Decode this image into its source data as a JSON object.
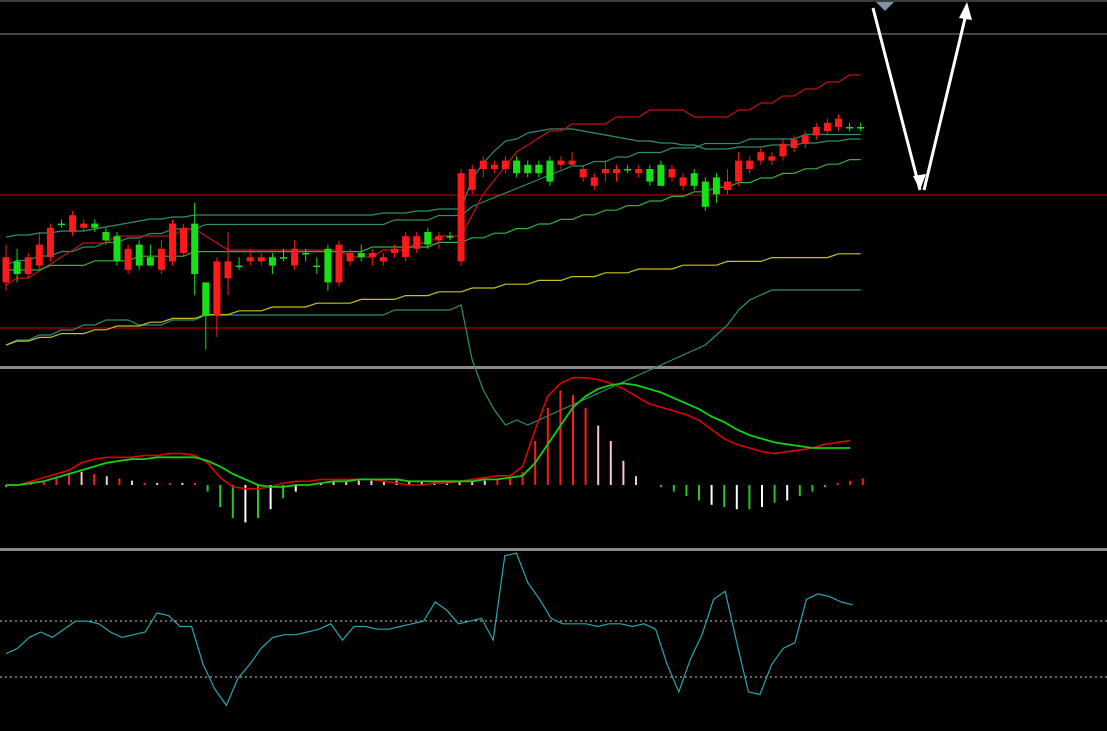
{
  "chart_data": [
    {
      "type": "candlestick",
      "panel": "price",
      "y_scale": "inverted_visual",
      "ylim": [
        0,
        100
      ],
      "colors": {
        "up": "#ff1a1a",
        "down": "#18e018",
        "boll": "#2c8f72",
        "ma_fast": "#c81010",
        "ma_mid": "#35b23a",
        "ma_slow": "#c8c020"
      },
      "ohlc": [
        [
          32,
          26,
          34,
          23
        ],
        [
          27,
          30,
          32,
          24
        ],
        [
          30,
          26,
          31,
          25
        ],
        [
          28,
          23,
          29,
          20
        ],
        [
          26,
          19,
          27,
          18
        ],
        [
          18,
          18,
          19,
          17
        ],
        [
          20,
          16,
          21,
          15
        ],
        [
          19,
          18,
          20,
          17
        ],
        [
          18,
          19,
          20,
          17
        ],
        [
          20,
          22,
          23,
          19
        ],
        [
          21,
          27,
          28,
          20
        ],
        [
          29,
          24,
          30,
          23
        ],
        [
          23,
          28,
          29,
          22
        ],
        [
          26,
          28,
          28,
          23
        ],
        [
          29,
          24,
          30,
          22
        ],
        [
          27,
          18,
          28,
          17
        ],
        [
          25,
          19,
          26,
          18
        ],
        [
          18,
          30,
          35,
          13
        ],
        [
          32,
          40,
          48,
          38
        ],
        [
          40,
          27,
          45,
          26
        ],
        [
          31,
          27,
          35,
          20
        ],
        [
          28,
          28,
          29,
          26
        ],
        [
          27,
          26,
          28,
          24
        ],
        [
          27,
          26,
          28,
          25
        ],
        [
          26,
          28,
          30,
          25
        ],
        [
          26,
          26,
          27,
          24
        ],
        [
          28,
          24,
          29,
          22
        ],
        [
          25,
          25,
          27,
          24
        ],
        [
          28,
          28,
          30,
          26
        ],
        [
          24,
          32,
          34,
          23
        ],
        [
          32,
          23,
          33,
          22
        ],
        [
          27,
          25,
          28,
          24
        ],
        [
          25,
          26,
          27,
          23
        ],
        [
          26,
          25,
          28,
          24
        ],
        [
          27,
          26,
          28,
          25
        ],
        [
          25,
          24,
          26,
          23
        ],
        [
          26,
          21,
          27,
          20
        ],
        [
          24,
          21,
          25,
          20
        ],
        [
          20,
          23,
          24,
          19
        ],
        [
          22,
          21,
          24,
          20
        ],
        [
          21,
          21,
          22,
          20
        ],
        [
          27,
          6,
          28,
          5
        ],
        [
          10,
          5,
          11,
          4
        ],
        [
          5,
          3,
          7,
          2
        ],
        [
          5,
          4,
          6,
          3
        ],
        [
          5,
          3,
          6,
          2
        ],
        [
          3,
          6,
          7,
          2
        ],
        [
          4,
          6,
          7,
          3
        ],
        [
          4,
          6,
          7,
          3
        ],
        [
          3,
          8,
          9,
          2
        ],
        [
          4,
          3,
          5,
          2
        ],
        [
          4,
          3,
          4,
          1
        ],
        [
          7,
          5,
          8,
          4
        ],
        [
          9,
          7,
          10,
          6
        ],
        [
          6,
          5,
          8,
          3
        ],
        [
          6,
          5,
          8,
          4
        ],
        [
          5,
          5,
          6,
          4
        ],
        [
          6,
          5,
          7,
          4
        ],
        [
          5,
          8,
          9,
          4
        ],
        [
          4,
          9,
          9,
          3
        ],
        [
          7,
          5,
          8,
          4
        ],
        [
          9,
          7,
          10,
          6
        ],
        [
          6,
          9,
          10,
          5
        ],
        [
          8,
          14,
          15,
          7
        ],
        [
          7,
          11,
          13,
          6
        ],
        [
          10,
          8,
          11,
          5
        ],
        [
          8,
          3,
          9,
          1
        ],
        [
          5,
          3,
          6,
          2
        ],
        [
          3,
          1,
          4,
          0
        ],
        [
          3,
          2,
          4,
          1
        ],
        [
          2,
          -1,
          3,
          -2
        ],
        [
          0,
          -2,
          1,
          -3
        ],
        [
          -1,
          -3,
          0,
          -4
        ],
        [
          -3,
          -5,
          -2,
          -6
        ],
        [
          -4,
          -6,
          -3,
          -7
        ],
        [
          -5,
          -7,
          -4,
          -8
        ],
        [
          -5,
          -5,
          -4,
          -6
        ],
        [
          -5,
          -5,
          -4,
          -6
        ]
      ],
      "series": [
        {
          "key": "boll_upper",
          "values": [
            49,
            48,
            48,
            47,
            47,
            46,
            46,
            46,
            45,
            44,
            43,
            42,
            41,
            40,
            40,
            39,
            39,
            38,
            38,
            38,
            38,
            38,
            38,
            38,
            38,
            38,
            38,
            38,
            38,
            38,
            38,
            38,
            38,
            38,
            37,
            37,
            37,
            36,
            36,
            35,
            35,
            35,
            20,
            12,
            6,
            1,
            0,
            -3,
            -4,
            -5,
            -5,
            -5,
            -4,
            -3,
            -2,
            -1,
            0,
            1,
            1,
            2,
            2,
            3,
            3,
            5,
            5,
            5,
            4,
            4,
            4,
            3,
            3,
            3,
            2,
            2,
            1,
            1,
            0,
            0
          ]
        },
        {
          "key": "boll_mid",
          "values": [
            35,
            34,
            34,
            33,
            33,
            32,
            32,
            31,
            31,
            30,
            30,
            29,
            29,
            28,
            28,
            27,
            27,
            27,
            26,
            26,
            26,
            26,
            26,
            26,
            26,
            26,
            26,
            26,
            26,
            26,
            26,
            26,
            26,
            26,
            26,
            25,
            25,
            25,
            25,
            24,
            24,
            24,
            22,
            21,
            20,
            19,
            18,
            17,
            16,
            15,
            14,
            13,
            13,
            12,
            12,
            11,
            11,
            10,
            10,
            10,
            9,
            9,
            9,
            8,
            8,
            8,
            8,
            7,
            7,
            7,
            7,
            7,
            6,
            6,
            6,
            6,
            6,
            6
          ]
        },
        {
          "key": "boll_lower",
          "values": [
            21,
            20,
            20,
            19,
            19,
            18,
            18,
            17,
            17,
            16,
            16,
            16,
            17,
            17,
            17,
            16,
            16,
            16,
            15,
            15,
            15,
            15,
            15,
            15,
            15,
            15,
            15,
            15,
            15,
            15,
            15,
            15,
            15,
            15,
            15,
            14,
            14,
            14,
            14,
            14,
            14,
            13,
            24,
            30,
            34,
            37,
            36,
            37,
            36,
            35,
            34,
            33,
            32,
            31,
            30,
            29,
            28,
            27,
            26,
            25,
            24,
            23,
            22,
            21,
            19,
            17,
            14,
            12,
            11,
            10,
            10,
            10,
            10,
            10,
            10,
            10,
            10,
            10
          ]
        },
        {
          "key": "ma_fast",
          "values": [
            30,
            29,
            29,
            28,
            27,
            26,
            25,
            24,
            24,
            24,
            23,
            23,
            23,
            23,
            23,
            23,
            22,
            22,
            23,
            24,
            25,
            25,
            25,
            25,
            25,
            25,
            25,
            25,
            25,
            25,
            25,
            26,
            26,
            26,
            25,
            25,
            25,
            24,
            24,
            23,
            23,
            23,
            20,
            17,
            15,
            13,
            11,
            10,
            9,
            8,
            8,
            7,
            7,
            7,
            7,
            6,
            6,
            6,
            5,
            5,
            5,
            5,
            6,
            6,
            6,
            6,
            5,
            5,
            4,
            4,
            3,
            3,
            2,
            2,
            1,
            1,
            0,
            0
          ]
        },
        {
          "key": "ma_mid",
          "values": [
            30,
            30,
            30,
            30,
            29,
            29,
            29,
            29,
            28,
            28,
            28,
            28,
            27,
            27,
            27,
            27,
            27,
            26,
            26,
            26,
            26,
            26,
            26,
            26,
            26,
            26,
            26,
            26,
            26,
            26,
            26,
            26,
            26,
            25,
            25,
            25,
            25,
            25,
            25,
            24,
            24,
            24,
            23,
            23,
            22,
            22,
            21,
            21,
            20,
            20,
            19,
            19,
            18,
            18,
            17,
            17,
            16,
            16,
            15,
            15,
            14,
            14,
            13,
            13,
            12,
            12,
            11,
            11,
            10,
            10,
            9,
            9,
            8,
            8,
            7,
            7,
            6,
            6
          ]
        },
        {
          "key": "ma_slow",
          "values": [
            45,
            44,
            44,
            43,
            43,
            42,
            42,
            42,
            41,
            41,
            40,
            40,
            40,
            39,
            39,
            38,
            38,
            38,
            37,
            37,
            37,
            36,
            36,
            36,
            35,
            35,
            35,
            35,
            34,
            34,
            34,
            34,
            33,
            33,
            33,
            33,
            32,
            32,
            32,
            31,
            31,
            31,
            30,
            30,
            30,
            29,
            29,
            29,
            28,
            28,
            28,
            27,
            27,
            27,
            26,
            26,
            26,
            25,
            25,
            25,
            25,
            24,
            24,
            24,
            24,
            23,
            23,
            23,
            23,
            22,
            22,
            22,
            22,
            22,
            22,
            21,
            21,
            21
          ]
        }
      ],
      "reference_lines": [
        {
          "level": 32,
          "color": "#cc0000"
        },
        {
          "level": 1,
          "color": "#888888"
        },
        {
          "level": 60,
          "color": "#cc0000"
        }
      ],
      "projection": [
        {
          "from": [
            0,
            0
          ],
          "to": [
            1,
            30
          ]
        },
        {
          "from": [
            1,
            30
          ],
          "to": [
            2,
            -6
          ]
        }
      ]
    },
    {
      "type": "macd",
      "panel": "macd",
      "ylim": [
        -1,
        1
      ],
      "colors": {
        "dif": "#e00000",
        "dea": "#12d012",
        "hist_pos_strong": "#ff1a1a",
        "hist_pos_weak": "#f8c8d0",
        "hist_neg_strong": "#20c820",
        "hist_neg_weak": "#ffffff"
      },
      "dif": [
        0,
        0,
        0.02,
        0.04,
        0.06,
        0.08,
        0.12,
        0.14,
        0.15,
        0.15,
        0.15,
        0.16,
        0.16,
        0.17,
        0.17,
        0.16,
        0.12,
        0.04,
        -0.01,
        -0.02,
        -0.02,
        -0.01,
        0.01,
        0.02,
        0.02,
        0.03,
        0.03,
        0.03,
        0.03,
        0.03,
        0.02,
        0.01,
        0,
        0,
        0.01,
        0.01,
        0.02,
        0.03,
        0.04,
        0.05,
        0.05,
        0.1,
        0.3,
        0.48,
        0.55,
        0.58,
        0.58,
        0.57,
        0.55,
        0.52,
        0.48,
        0.44,
        0.42,
        0.4,
        0.38,
        0.35,
        0.3,
        0.25,
        0.22,
        0.2,
        0.18,
        0.17,
        0.18,
        0.19,
        0.2,
        0.22,
        0.23,
        0.24
      ],
      "dea": [
        0,
        0,
        0.01,
        0.02,
        0.04,
        0.06,
        0.08,
        0.1,
        0.12,
        0.13,
        0.14,
        0.14,
        0.15,
        0.15,
        0.15,
        0.15,
        0.13,
        0.1,
        0.06,
        0.03,
        0,
        -0.01,
        -0.01,
        0,
        0,
        0.01,
        0.02,
        0.02,
        0.03,
        0.03,
        0.03,
        0.03,
        0.02,
        0.02,
        0.02,
        0.02,
        0.02,
        0.02,
        0.03,
        0.03,
        0.04,
        0.05,
        0.12,
        0.22,
        0.32,
        0.42,
        0.48,
        0.52,
        0.54,
        0.55,
        0.54,
        0.52,
        0.5,
        0.47,
        0.44,
        0.41,
        0.37,
        0.34,
        0.3,
        0.27,
        0.25,
        0.23,
        0.22,
        0.21,
        0.2,
        0.2,
        0.2,
        0.2
      ],
      "hist": [
        -0.02,
        0,
        0.02,
        0.04,
        0.06,
        0.1,
        0.12,
        0.1,
        0.08,
        0.06,
        0.04,
        0.02,
        0.02,
        0.02,
        0.02,
        0.02,
        -0.06,
        -0.2,
        -0.3,
        -0.34,
        -0.3,
        -0.22,
        -0.12,
        -0.06,
        0,
        0.02,
        0.04,
        0.04,
        0.04,
        0.04,
        0.04,
        0.04,
        0.04,
        0.04,
        0.04,
        0.04,
        0.04,
        0.04,
        0.04,
        0.06,
        0.06,
        0.12,
        0.4,
        0.7,
        0.86,
        0.82,
        0.7,
        0.54,
        0.4,
        0.22,
        0.08,
        0,
        -0.02,
        -0.06,
        -0.1,
        -0.14,
        -0.18,
        -0.2,
        -0.22,
        -0.22,
        -0.2,
        -0.16,
        -0.14,
        -0.1,
        -0.06,
        -0.02,
        0.02,
        0.04,
        0.06
      ]
    },
    {
      "type": "line",
      "panel": "oscillator",
      "ylim": [
        0,
        100
      ],
      "colors": {
        "line": "#2aa6b0",
        "bands": "#cccccc"
      },
      "bands": [
        70,
        30
      ],
      "values": [
        48,
        52,
        60,
        64,
        60,
        66,
        72,
        72,
        70,
        64,
        60,
        62,
        64,
        78,
        76,
        68,
        68,
        40,
        22,
        10,
        30,
        40,
        52,
        60,
        62,
        62,
        64,
        66,
        70,
        58,
        68,
        68,
        66,
        66,
        68,
        70,
        72,
        86,
        80,
        70,
        72,
        74,
        58,
        120,
        122,
        100,
        88,
        74,
        70,
        70,
        70,
        68,
        70,
        70,
        68,
        70,
        66,
        40,
        20,
        44,
        62,
        88,
        94,
        56,
        20,
        18,
        40,
        52,
        56,
        88,
        92,
        90,
        86,
        84
      ]
    }
  ]
}
